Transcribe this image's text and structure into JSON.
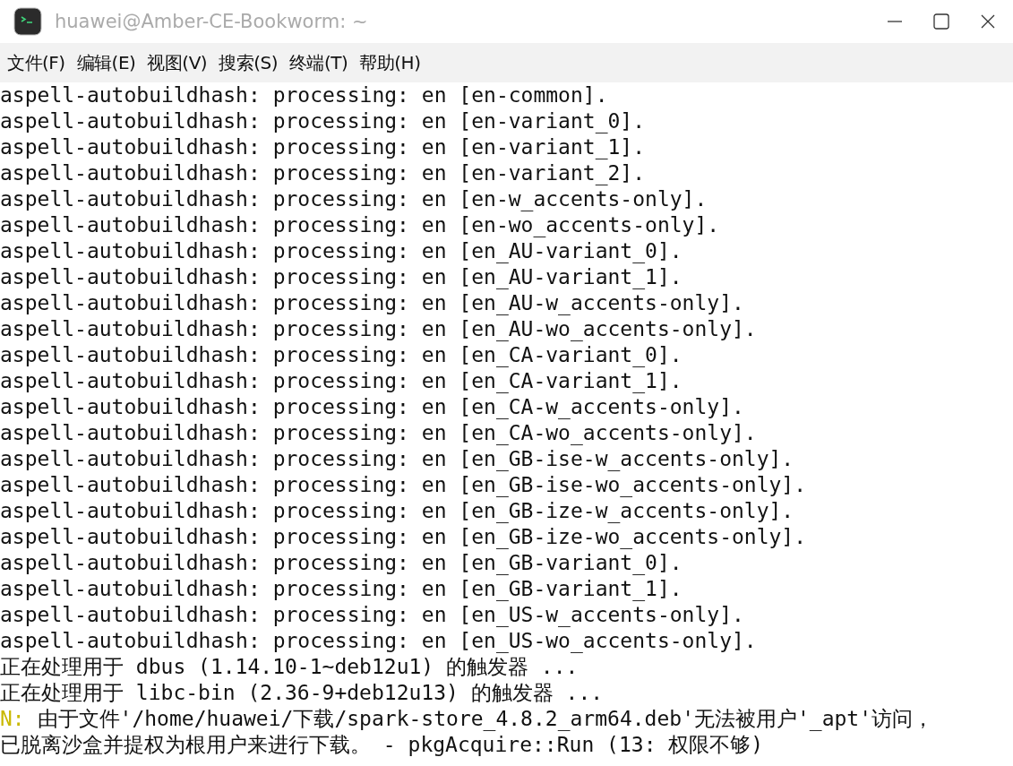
{
  "window": {
    "title": "huawei@Amber-CE-Bookworm: ~"
  },
  "menu": [
    "文件(F)",
    "编辑(E)",
    "视图(V)",
    "搜索(S)",
    "终端(T)",
    "帮助(H)"
  ],
  "terminal": {
    "lines": [
      {
        "text": "aspell-autobuildhash: processing: en [en-common]."
      },
      {
        "text": "aspell-autobuildhash: processing: en [en-variant_0]."
      },
      {
        "text": "aspell-autobuildhash: processing: en [en-variant_1]."
      },
      {
        "text": "aspell-autobuildhash: processing: en [en-variant_2]."
      },
      {
        "text": "aspell-autobuildhash: processing: en [en-w_accents-only]."
      },
      {
        "text": "aspell-autobuildhash: processing: en [en-wo_accents-only]."
      },
      {
        "text": "aspell-autobuildhash: processing: en [en_AU-variant_0]."
      },
      {
        "text": "aspell-autobuildhash: processing: en [en_AU-variant_1]."
      },
      {
        "text": "aspell-autobuildhash: processing: en [en_AU-w_accents-only]."
      },
      {
        "text": "aspell-autobuildhash: processing: en [en_AU-wo_accents-only]."
      },
      {
        "text": "aspell-autobuildhash: processing: en [en_CA-variant_0]."
      },
      {
        "text": "aspell-autobuildhash: processing: en [en_CA-variant_1]."
      },
      {
        "text": "aspell-autobuildhash: processing: en [en_CA-w_accents-only]."
      },
      {
        "text": "aspell-autobuildhash: processing: en [en_CA-wo_accents-only]."
      },
      {
        "text": "aspell-autobuildhash: processing: en [en_GB-ise-w_accents-only]."
      },
      {
        "text": "aspell-autobuildhash: processing: en [en_GB-ise-wo_accents-only]."
      },
      {
        "text": "aspell-autobuildhash: processing: en [en_GB-ize-w_accents-only]."
      },
      {
        "text": "aspell-autobuildhash: processing: en [en_GB-ize-wo_accents-only]."
      },
      {
        "text": "aspell-autobuildhash: processing: en [en_GB-variant_0]."
      },
      {
        "text": "aspell-autobuildhash: processing: en [en_GB-variant_1]."
      },
      {
        "text": "aspell-autobuildhash: processing: en [en_US-w_accents-only]."
      },
      {
        "text": "aspell-autobuildhash: processing: en [en_US-wo_accents-only]."
      },
      {
        "text": "正在处理用于 dbus (1.14.10-1~deb12u1) 的触发器 ..."
      },
      {
        "text": "正在处理用于 libc-bin (2.36-9+deb12u13) 的触发器 ..."
      },
      {
        "prefix": "N:",
        "text": " 由于文件'/home/huawei/下载/spark-store_4.8.2_arm64.deb'无法被用户'_apt'访问，"
      },
      {
        "text": "已脱离沙盒并提权为根用户来进行下载。 - pkgAcquire::Run (13: 权限不够)"
      }
    ]
  }
}
